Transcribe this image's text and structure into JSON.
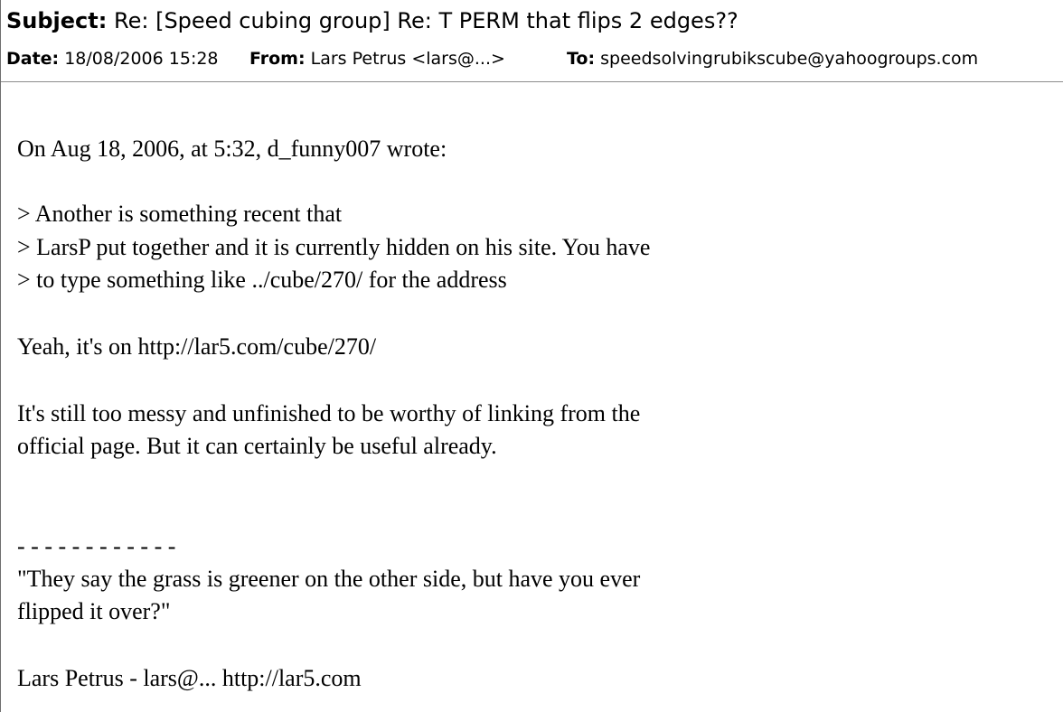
{
  "header": {
    "subject_label": "Subject:",
    "subject": "Re: [Speed cubing group] Re: T PERM that flips 2 edges??",
    "date_label": "Date:",
    "date": "18/08/2006 15:28",
    "from_label": "From:",
    "from": "Lars Petrus <lars@...>",
    "to_label": "To:",
    "to": "speedsolvingrubikscube@yahoogroups.com"
  },
  "body": {
    "lines": [
      "On Aug 18, 2006, at 5:32, d_funny007 wrote:",
      "> Another is something recent that",
      "> LarsP put together and it is currently hidden on his site. You have",
      "> to type something like ../cube/270/ for the address",
      "Yeah, it's on http://lar5.com/cube/270/",
      "It's still too messy and unfinished to be worthy of linking from the",
      "official page. But it can certainly be useful already.",
      "- - - - - - - - - - - -",
      "\"They say the grass is greener on the other side, but have you ever",
      "flipped it over?\"",
      "Lars Petrus - lars@... http://lar5.com"
    ]
  }
}
